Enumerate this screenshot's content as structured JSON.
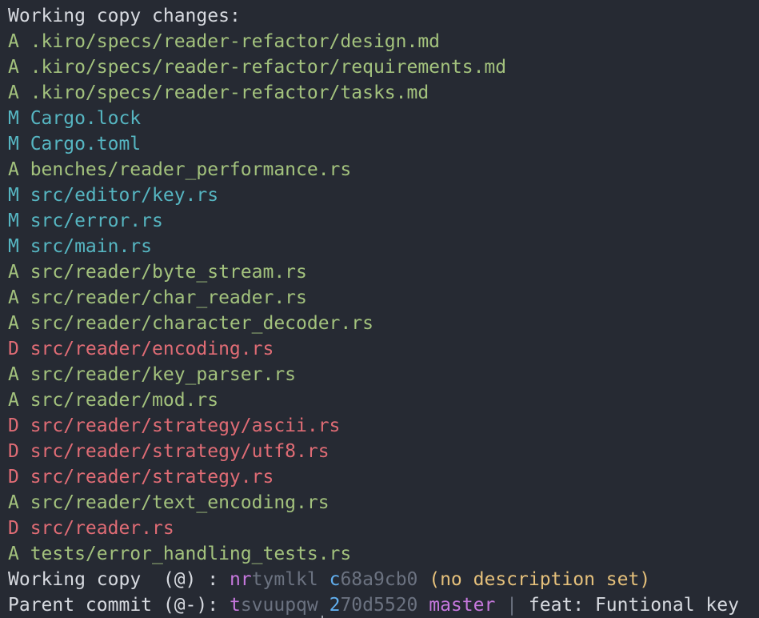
{
  "header": {
    "title": "Working copy changes:"
  },
  "colors": {
    "added": "#a3c27d",
    "modified": "#56b6c2",
    "deleted": "#e06c75",
    "change_id_prefix": "#c678dd",
    "commit_hash_prefix": "#61afef",
    "muted": "#6b7280",
    "warning": "#e5c07b",
    "background": "#262a33"
  },
  "changes": [
    {
      "status": "A",
      "path": ".kiro/specs/reader-refactor/design.md"
    },
    {
      "status": "A",
      "path": ".kiro/specs/reader-refactor/requirements.md"
    },
    {
      "status": "A",
      "path": ".kiro/specs/reader-refactor/tasks.md"
    },
    {
      "status": "M",
      "path": "Cargo.lock"
    },
    {
      "status": "M",
      "path": "Cargo.toml"
    },
    {
      "status": "A",
      "path": "benches/reader_performance.rs"
    },
    {
      "status": "M",
      "path": "src/editor/key.rs"
    },
    {
      "status": "M",
      "path": "src/error.rs"
    },
    {
      "status": "M",
      "path": "src/main.rs"
    },
    {
      "status": "A",
      "path": "src/reader/byte_stream.rs"
    },
    {
      "status": "A",
      "path": "src/reader/char_reader.rs"
    },
    {
      "status": "A",
      "path": "src/reader/character_decoder.rs"
    },
    {
      "status": "D",
      "path": "src/reader/encoding.rs"
    },
    {
      "status": "A",
      "path": "src/reader/key_parser.rs"
    },
    {
      "status": "A",
      "path": "src/reader/mod.rs"
    },
    {
      "status": "D",
      "path": "src/reader/strategy/ascii.rs"
    },
    {
      "status": "D",
      "path": "src/reader/strategy/utf8.rs"
    },
    {
      "status": "D",
      "path": "src/reader/strategy.rs"
    },
    {
      "status": "A",
      "path": "src/reader/text_encoding.rs"
    },
    {
      "status": "D",
      "path": "src/reader.rs"
    },
    {
      "status": "A",
      "path": "tests/error_handling_tests.rs"
    }
  ],
  "working_copy": {
    "label": "Working copy  (@) : ",
    "change_id_prefix": "nr",
    "change_id_rest": "tymlkl",
    "commit_hash_prefix": "c",
    "commit_hash_rest": "68a9cb0",
    "description": "(no description set)"
  },
  "parent_commit": {
    "label": "Parent commit (@-): ",
    "change_id_prefix": "t",
    "change_id_rest": "svuupqw",
    "commit_hash_prefix": "2",
    "commit_hash_rest": "70d5520",
    "bookmark": "master",
    "divider": "|",
    "description": "feat: Funtional key"
  }
}
